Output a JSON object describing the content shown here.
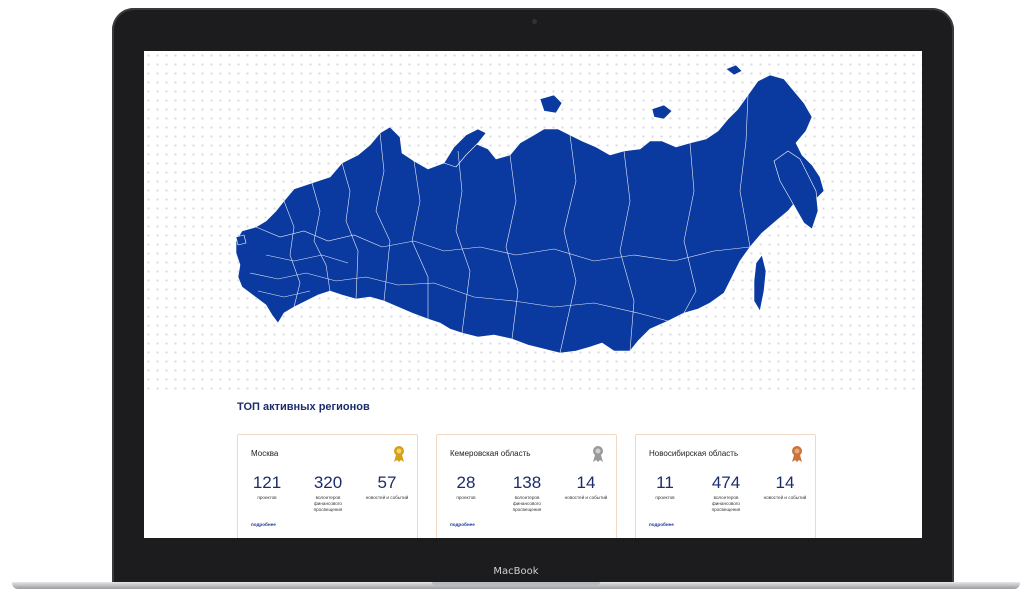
{
  "device": {
    "brand_label": "MacBook"
  },
  "map": {
    "fill_color": "#0a3aa0",
    "border_color": "#ffffff"
  },
  "section": {
    "title": "ТОП активных регионов"
  },
  "cards": [
    {
      "region": "Москва",
      "medal": "gold-medal-icon",
      "medal_color": "#d4a017",
      "stats": [
        {
          "value": "121",
          "label": "проектов"
        },
        {
          "value": "320",
          "label": "волонтеров финансового просвещения"
        },
        {
          "value": "57",
          "label": "новостей и событий"
        }
      ],
      "more_label": "подробнее"
    },
    {
      "region": "Кемеровская область",
      "medal": "silver-medal-icon",
      "medal_color": "#9a9a9a",
      "stats": [
        {
          "value": "28",
          "label": "проектов"
        },
        {
          "value": "138",
          "label": "волонтеров финансового просвещения"
        },
        {
          "value": "14",
          "label": "новостей и событий"
        }
      ],
      "more_label": "подробнее"
    },
    {
      "region": "Новосибирская область",
      "medal": "bronze-medal-icon",
      "medal_color": "#c8743a",
      "stats": [
        {
          "value": "11",
          "label": "проектов"
        },
        {
          "value": "474",
          "label": "волонтеров финансового просвещения"
        },
        {
          "value": "14",
          "label": "новостей и событий"
        }
      ],
      "more_label": "подробнее"
    }
  ]
}
